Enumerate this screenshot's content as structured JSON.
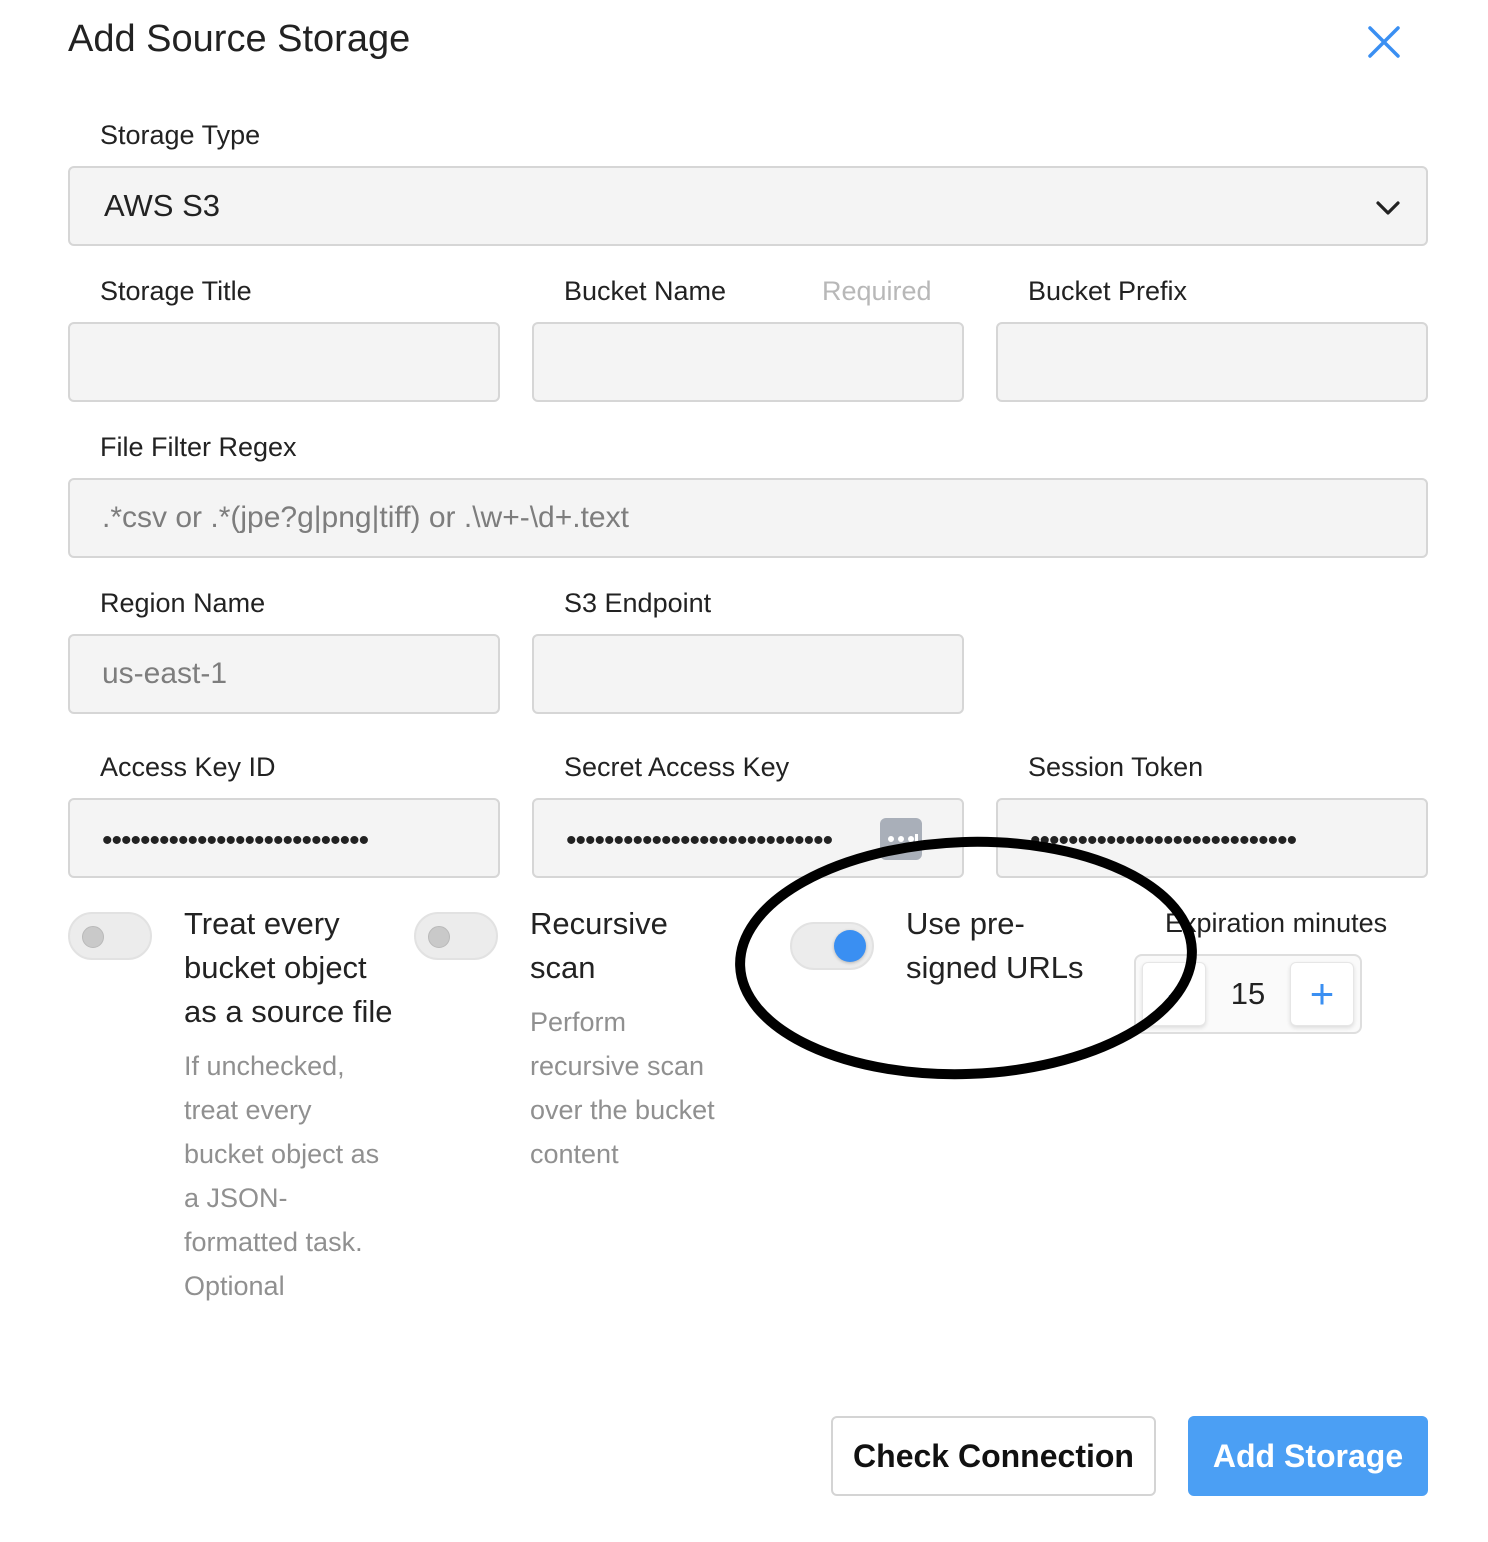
{
  "dialog": {
    "title": "Add Source Storage",
    "close_icon": "close-icon"
  },
  "storage_type": {
    "label": "Storage Type",
    "value": "AWS S3",
    "icon": "chevron-down-icon"
  },
  "storage_title": {
    "label": "Storage Title",
    "value": ""
  },
  "bucket_name": {
    "label": "Bucket Name",
    "hint": "Required",
    "value": ""
  },
  "bucket_prefix": {
    "label": "Bucket Prefix",
    "value": ""
  },
  "file_filter": {
    "label": "File Filter Regex",
    "placeholder": ".*csv or .*(jpe?g|png|tiff) or .\\w+-\\d+.text"
  },
  "region": {
    "label": "Region Name",
    "placeholder": "us-east-1"
  },
  "s3_endpoint": {
    "label": "S3 Endpoint",
    "value": ""
  },
  "access_key": {
    "label": "Access Key ID",
    "masked": "••••••••••••••••••••••••••••"
  },
  "secret_key": {
    "label": "Secret Access Key",
    "masked": "••••••••••••••••••••••••••••",
    "icon": "password-manager-icon"
  },
  "session_token": {
    "label": "Session Token",
    "masked": "••••••••••••••••••••••••••••"
  },
  "options": {
    "treat_bucket": {
      "title": "Treat every bucket object as a source file",
      "description": "If unchecked, treat every bucket object as a JSON-formatted task. Optional",
      "checked": false
    },
    "recursive": {
      "title": "Recursive scan",
      "description": "Perform recursive scan over the bucket content",
      "checked": false
    },
    "presigned": {
      "title": "Use pre-signed URLs",
      "checked": true
    }
  },
  "expiration": {
    "label": "Expiration minutes",
    "value": "15",
    "minus": "-",
    "plus": "+"
  },
  "buttons": {
    "check": "Check Connection",
    "add": "Add Storage"
  },
  "colors": {
    "accent": "#3a8ff2",
    "primary_button": "#4b9ff4",
    "annotation": "#000000"
  }
}
